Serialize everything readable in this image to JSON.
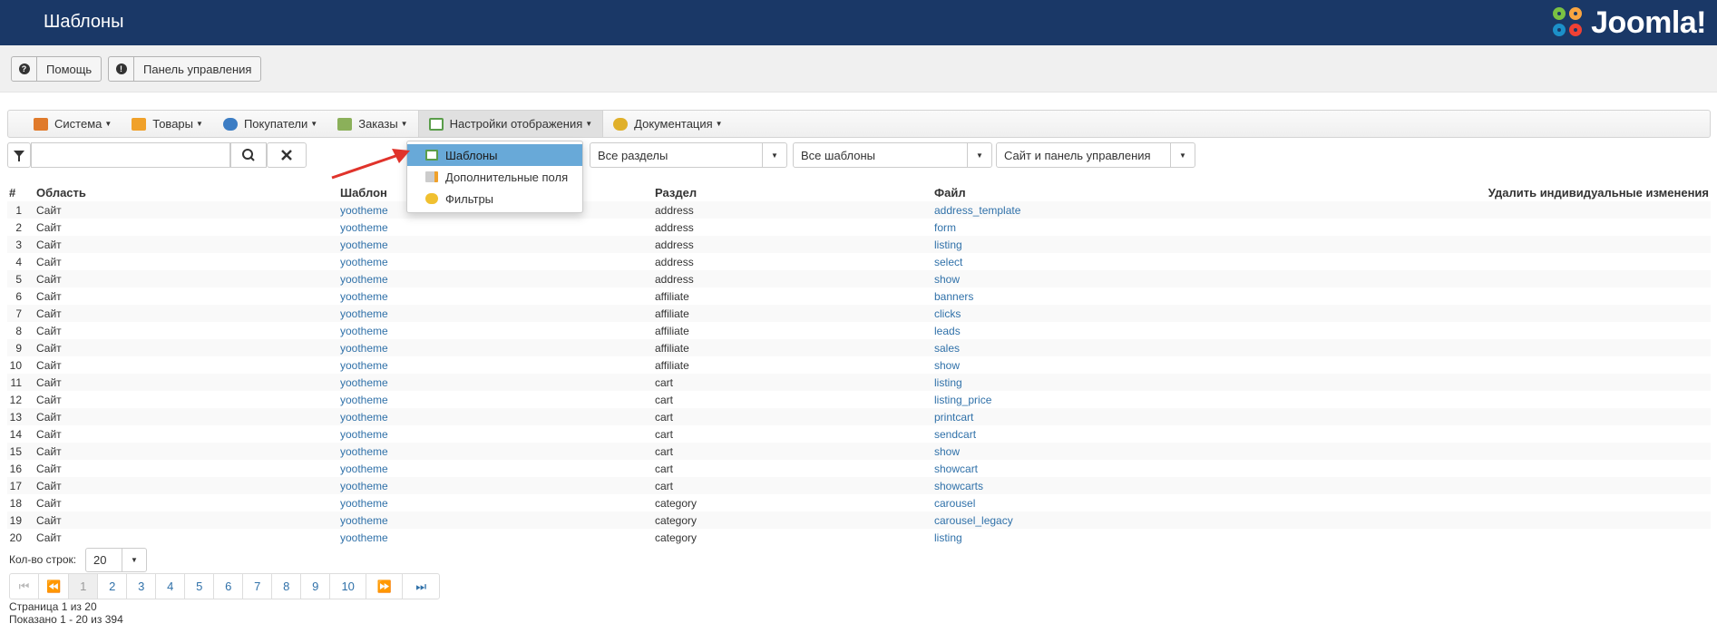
{
  "header": {
    "title": "Шаблоны",
    "logo_text": "Joomla!"
  },
  "toolbar": {
    "help_label": "Помощь",
    "cpanel_label": "Панель управления"
  },
  "menu": [
    {
      "label": "Система",
      "icon": "wrench-icon",
      "color": "#e07a2b"
    },
    {
      "label": "Товары",
      "icon": "box-icon",
      "color": "#f0a12a"
    },
    {
      "label": "Покупатели",
      "icon": "users-icon",
      "color": "#3c7dc4"
    },
    {
      "label": "Заказы",
      "icon": "orders-icon",
      "color": "#8bb05a"
    },
    {
      "label": "Настройки отображения",
      "icon": "display-icon",
      "color": "#5a9d4a"
    },
    {
      "label": "Документация",
      "icon": "docs-icon",
      "color": "#e0b02a"
    }
  ],
  "dropdown": [
    {
      "label": "Шаблоны",
      "selected": true
    },
    {
      "label": "Дополнительные поля",
      "selected": false
    },
    {
      "label": "Фильтры",
      "selected": false
    }
  ],
  "filters": {
    "search_value": "",
    "sections": "Все разделы",
    "templates": "Все шаблоны",
    "scope": "Сайт и панель управления"
  },
  "table": {
    "headers": [
      "#",
      "Область",
      "Шаблон",
      "Раздел",
      "Файл",
      "Удалить индивидуальные изменения"
    ],
    "rows": [
      [
        "1",
        "Сайт",
        "yootheme",
        "address",
        "address_template"
      ],
      [
        "2",
        "Сайт",
        "yootheme",
        "address",
        "form"
      ],
      [
        "3",
        "Сайт",
        "yootheme",
        "address",
        "listing"
      ],
      [
        "4",
        "Сайт",
        "yootheme",
        "address",
        "select"
      ],
      [
        "5",
        "Сайт",
        "yootheme",
        "address",
        "show"
      ],
      [
        "6",
        "Сайт",
        "yootheme",
        "affiliate",
        "banners"
      ],
      [
        "7",
        "Сайт",
        "yootheme",
        "affiliate",
        "clicks"
      ],
      [
        "8",
        "Сайт",
        "yootheme",
        "affiliate",
        "leads"
      ],
      [
        "9",
        "Сайт",
        "yootheme",
        "affiliate",
        "sales"
      ],
      [
        "10",
        "Сайт",
        "yootheme",
        "affiliate",
        "show"
      ],
      [
        "11",
        "Сайт",
        "yootheme",
        "cart",
        "listing"
      ],
      [
        "12",
        "Сайт",
        "yootheme",
        "cart",
        "listing_price"
      ],
      [
        "13",
        "Сайт",
        "yootheme",
        "cart",
        "printcart"
      ],
      [
        "14",
        "Сайт",
        "yootheme",
        "cart",
        "sendcart"
      ],
      [
        "15",
        "Сайт",
        "yootheme",
        "cart",
        "show"
      ],
      [
        "16",
        "Сайт",
        "yootheme",
        "cart",
        "showcart"
      ],
      [
        "17",
        "Сайт",
        "yootheme",
        "cart",
        "showcarts"
      ],
      [
        "18",
        "Сайт",
        "yootheme",
        "category",
        "carousel"
      ],
      [
        "19",
        "Сайт",
        "yootheme",
        "category",
        "carousel_legacy"
      ],
      [
        "20",
        "Сайт",
        "yootheme",
        "category",
        "listing"
      ]
    ]
  },
  "pagination": {
    "rows_label": "Кол-во строк:",
    "rows_value": "20",
    "pages": [
      "1",
      "2",
      "3",
      "4",
      "5",
      "6",
      "7",
      "8",
      "9",
      "10"
    ],
    "current_page": "1",
    "page_info": "Страница 1 из 20",
    "shown_info": "Показано 1 - 20 из 394"
  },
  "colors": {
    "header_bg": "#1a3867",
    "link": "#3071a9",
    "selected_item": "#68a9d8",
    "arrow": "#e0332b"
  }
}
